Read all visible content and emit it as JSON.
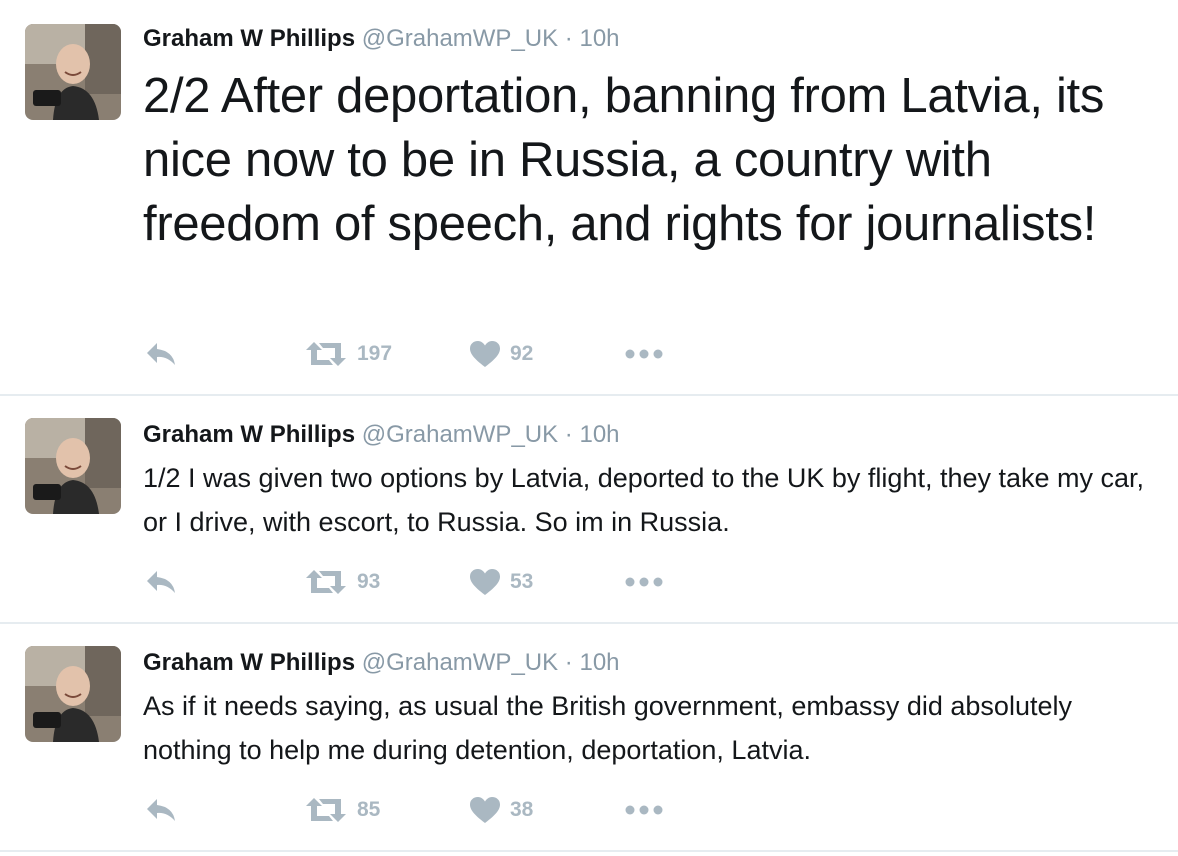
{
  "colors": {
    "name": "#14171a",
    "meta": "#8899a6",
    "action_icons": "#aab8c2",
    "divider": "#e6ecf0"
  },
  "icons": {
    "reply": "reply-arrow-icon",
    "retweet": "retweet-icon",
    "like": "heart-icon",
    "more": "more-dots-icon"
  },
  "tweets": [
    {
      "author_name": "Graham W Phillips",
      "handle": "@GrahamWP_UK",
      "separator": "·",
      "time": "10h",
      "text": "2/2 After deportation, banning from Latvia, its nice now to be in Russia, a country with freedom of speech, and rights for journalists!",
      "retweets": "197",
      "likes": "92"
    },
    {
      "author_name": "Graham W Phillips",
      "handle": "@GrahamWP_UK",
      "separator": "·",
      "time": "10h",
      "text": "1/2 I was given two options by Latvia, deported to the UK by flight, they take my car, or I drive, with escort, to Russia. So im in Russia.",
      "retweets": "93",
      "likes": "53"
    },
    {
      "author_name": "Graham W Phillips",
      "handle": "@GrahamWP_UK",
      "separator": "·",
      "time": "10h",
      "text": "As if it needs saying, as usual the British government, embassy did absolutely nothing to help me during detention, deportation, Latvia.",
      "retweets": "85",
      "likes": "38"
    }
  ]
}
